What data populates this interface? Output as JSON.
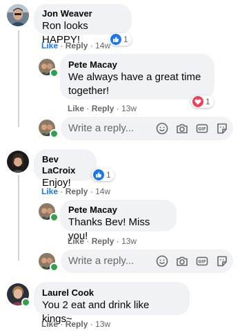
{
  "comments": [
    {
      "author": "Jon Weaver",
      "text": "Ron looks HAPPY!",
      "like": "Like",
      "reply": "Reply",
      "time": "14w",
      "reaction_count": "1",
      "reaction": "like"
    },
    {
      "author": "Pete Macay",
      "text": "We always have a great time together!",
      "like": "Like",
      "reply": "Reply",
      "time": "13w",
      "reaction_count": "1",
      "reaction": "love"
    },
    {
      "author": "Bev LaCroix",
      "text": "Enjoy!",
      "like": "Like",
      "reply": "Reply",
      "time": "14w",
      "reaction_count": "1",
      "reaction": "like"
    },
    {
      "author": "Pete Macay",
      "text": "Thanks Bev! Miss you!",
      "like": "Like",
      "reply": "Reply",
      "time": "13w"
    },
    {
      "author": "Laurel Cook",
      "text": "You 2 eat and drink like kings~",
      "like": "Like",
      "reply": "Reply",
      "time": "13w"
    }
  ],
  "reply_box": {
    "placeholder": "Write a reply..."
  },
  "separator": "·",
  "colors": {
    "bubble": "#f0f2f5",
    "like_blue": "#1877f2",
    "love_red": "#f33e58",
    "online": "#31a24c",
    "meta": "#65676b"
  },
  "icons": [
    "like-reaction-icon",
    "love-reaction-icon",
    "emoji-icon",
    "camera-icon",
    "gif-icon",
    "sticker-icon"
  ]
}
